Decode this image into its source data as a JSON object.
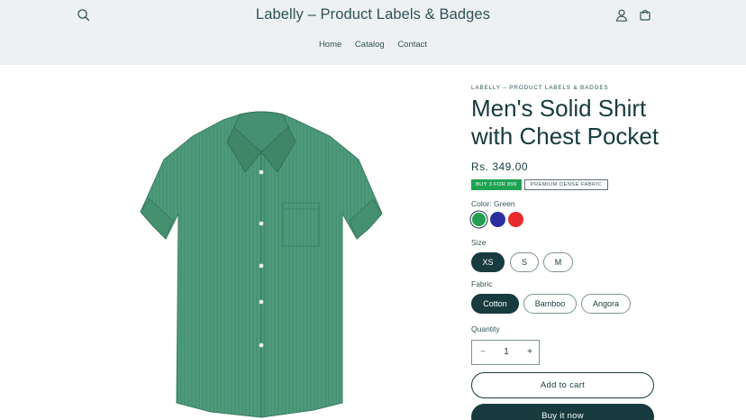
{
  "header": {
    "store_title": "Labelly – Product Labels & Badges",
    "nav": [
      "Home",
      "Catalog",
      "Contact"
    ],
    "icons": [
      "search-icon",
      "account-icon",
      "cart-icon"
    ]
  },
  "product": {
    "vendor": "LABELLY – PRODUCT LABELS & BADGES",
    "title": "Men's Solid Shirt with Chest Pocket",
    "price": "Rs. 349.00",
    "badges": [
      "BUY 3 FOR 899",
      "PREMIUM DENSE FABRIC"
    ],
    "color_label": "Color: Green",
    "colors": [
      {
        "name": "Green",
        "hex": "#22a052",
        "selected": true
      },
      {
        "name": "Blue",
        "hex": "#2b2f9e",
        "selected": false
      },
      {
        "name": "Red",
        "hex": "#ea2a2a",
        "selected": false
      }
    ],
    "size_label": "Size",
    "sizes": [
      "XS",
      "S",
      "M"
    ],
    "selected_size": "XS",
    "fabric_label": "Fabric",
    "fabrics": [
      "Cotton",
      "Bamboo",
      "Angora"
    ],
    "selected_fabric": "Cotton",
    "quantity_label": "Quantity",
    "quantity": "1",
    "minus_symbol": "−",
    "plus_symbol": "+",
    "add_to_cart": "Add to cart",
    "buy_now": "Buy it now"
  },
  "colors": {
    "header_bg": "#eef1f2",
    "primary": "#173b3e",
    "badge_green": "#1fa352",
    "shirt": "#4e9b7c"
  }
}
